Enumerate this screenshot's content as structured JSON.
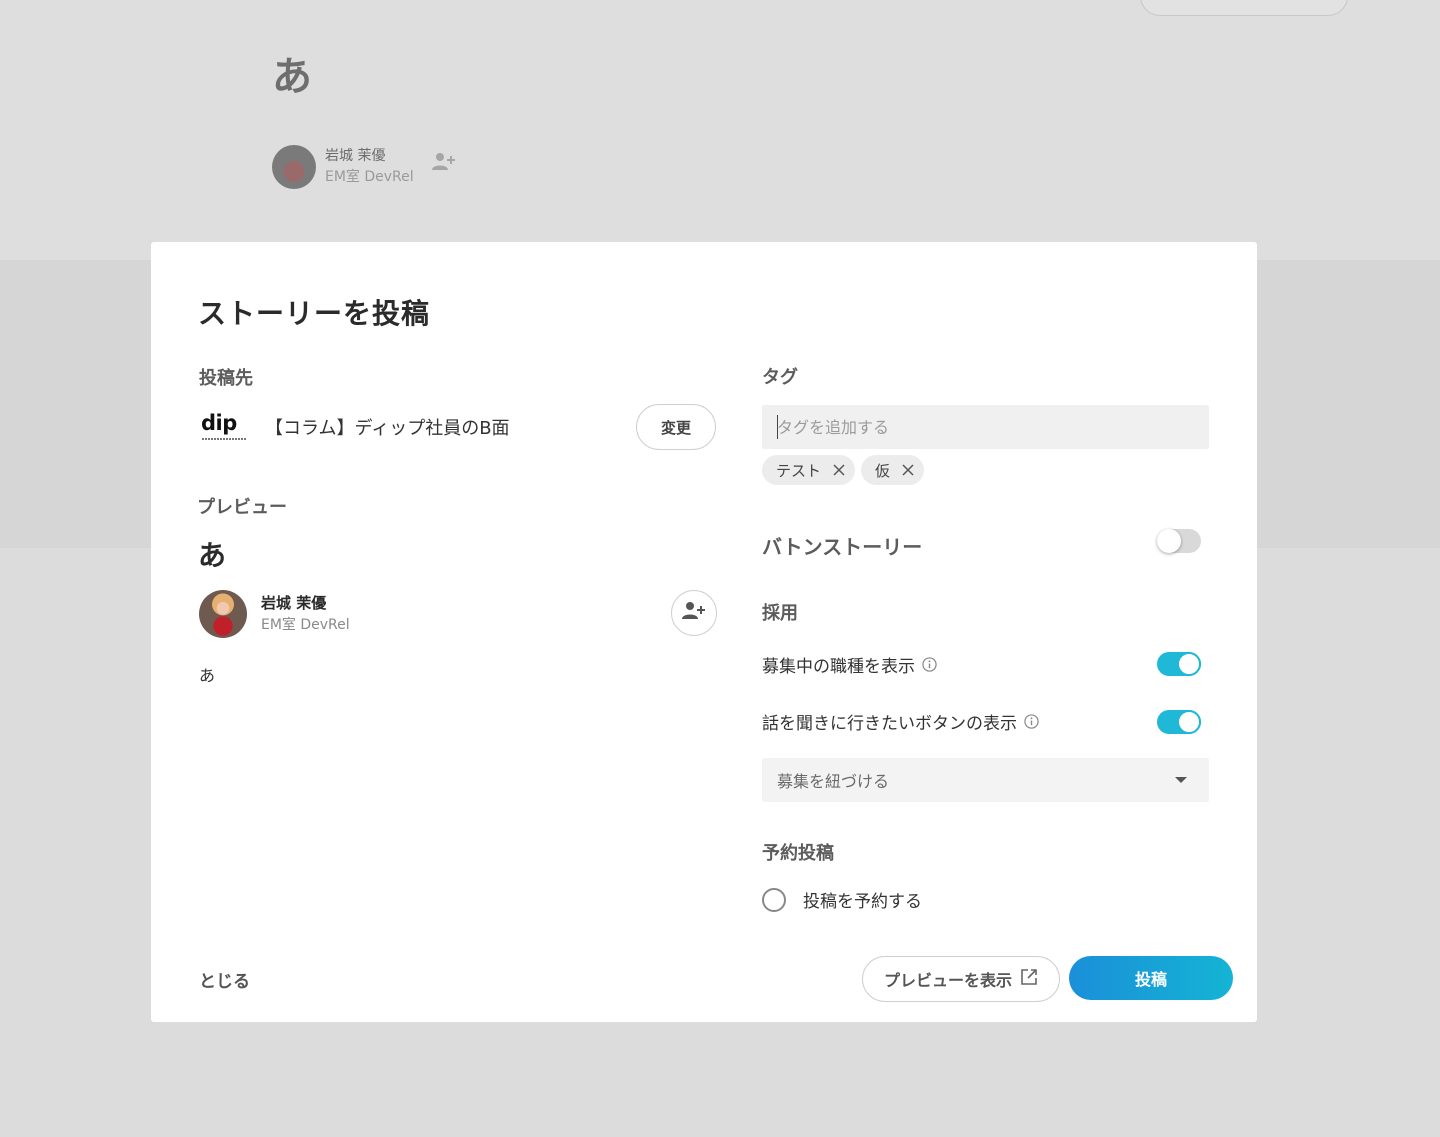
{
  "background": {
    "story_title": "あ",
    "author_name": "岩城 茉優",
    "author_dept": "EM室 DevRel"
  },
  "modal": {
    "title": "ストーリーを投稿",
    "destination": {
      "label": "投稿先",
      "logo_text": "dip",
      "name": "【コラム】ディップ社員のB面",
      "change_label": "変更"
    },
    "preview": {
      "label": "プレビュー",
      "title": "あ",
      "author_name": "岩城 茉優",
      "author_dept": "EM室 DevRel",
      "body": "あ"
    },
    "tags": {
      "label": "タグ",
      "placeholder": "タグを追加する",
      "items": [
        "テスト",
        "仮"
      ]
    },
    "baton_story": {
      "label": "バトンストーリー",
      "enabled": false
    },
    "recruit": {
      "label": "採用",
      "show_jobs_label": "募集中の職種を表示",
      "show_jobs_enabled": true,
      "show_visit_button_label": "話を聞きに行きたいボタンの表示",
      "show_visit_button_enabled": true,
      "link_placeholder": "募集を紐づける"
    },
    "schedule": {
      "label": "予約投稿",
      "option_label": "投稿を予約する",
      "checked": false
    },
    "footer": {
      "close_label": "とじる",
      "preview_label": "プレビューを表示",
      "post_label": "投稿"
    }
  },
  "colors": {
    "accent": "#1fb8d6",
    "post_gradient_start": "#1b8fd9",
    "post_gradient_end": "#14b4d4",
    "overlay": "#dcdcdc"
  },
  "icons": [
    "user-plus-icon",
    "close-icon",
    "info-icon",
    "chevron-down-icon",
    "external-link-icon"
  ]
}
